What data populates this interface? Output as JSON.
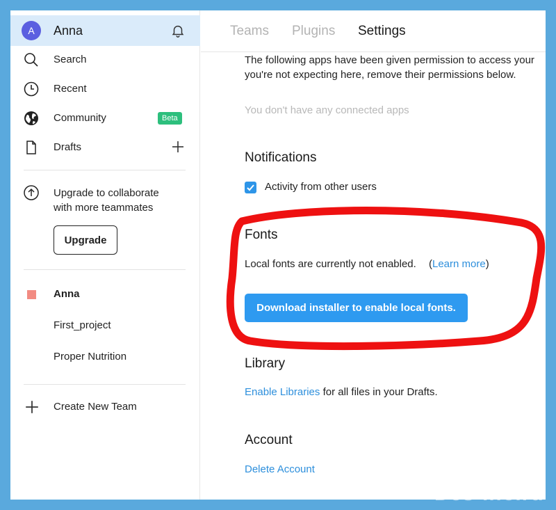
{
  "sidebar": {
    "user": {
      "avatar_letter": "A",
      "name": "Anna"
    },
    "nav": [
      {
        "label": "Search",
        "icon": "search-icon"
      },
      {
        "label": "Recent",
        "icon": "clock-icon"
      },
      {
        "label": "Community",
        "icon": "globe-icon",
        "badge": "Beta"
      },
      {
        "label": "Drafts",
        "icon": "file-icon"
      }
    ],
    "upgrade": {
      "line1": "Upgrade to collaborate",
      "line2": "with more teammates",
      "button_label": "Upgrade"
    },
    "team": {
      "name": "Anna",
      "color": "#f28b82",
      "projects": [
        "First_project",
        "Proper Nutrition"
      ]
    },
    "create_team_label": "Create New Team"
  },
  "tabs": [
    {
      "label": "Teams",
      "active": false
    },
    {
      "label": "Plugins",
      "active": false
    },
    {
      "label": "Settings",
      "active": true
    }
  ],
  "settings": {
    "permissions_line1": "The following apps have been given permission to access your",
    "permissions_line2": "you're not expecting here, remove their permissions below.",
    "no_apps_text": "You don't have any connected apps",
    "notifications": {
      "title": "Notifications",
      "checkbox_label": "Activity from other users",
      "checked": true
    },
    "fonts": {
      "title": "Fonts",
      "status_text": "Local fonts are currently not enabled.",
      "paren_open": "(",
      "learn_more": "Learn more",
      "paren_close": ")",
      "button_label": "Download installer to enable local fonts."
    },
    "library": {
      "title": "Library",
      "link": "Enable Libraries",
      "rest": " for all files in your Drafts."
    },
    "account": {
      "title": "Account",
      "delete_link": "Delete Account"
    }
  },
  "watermark": "Des-life.ru",
  "colors": {
    "accent": "#2e9af0",
    "link": "#2d8fdc",
    "badge": "#2dbf7d",
    "highlight": "#ee1111",
    "background": "#5aa9dd"
  }
}
